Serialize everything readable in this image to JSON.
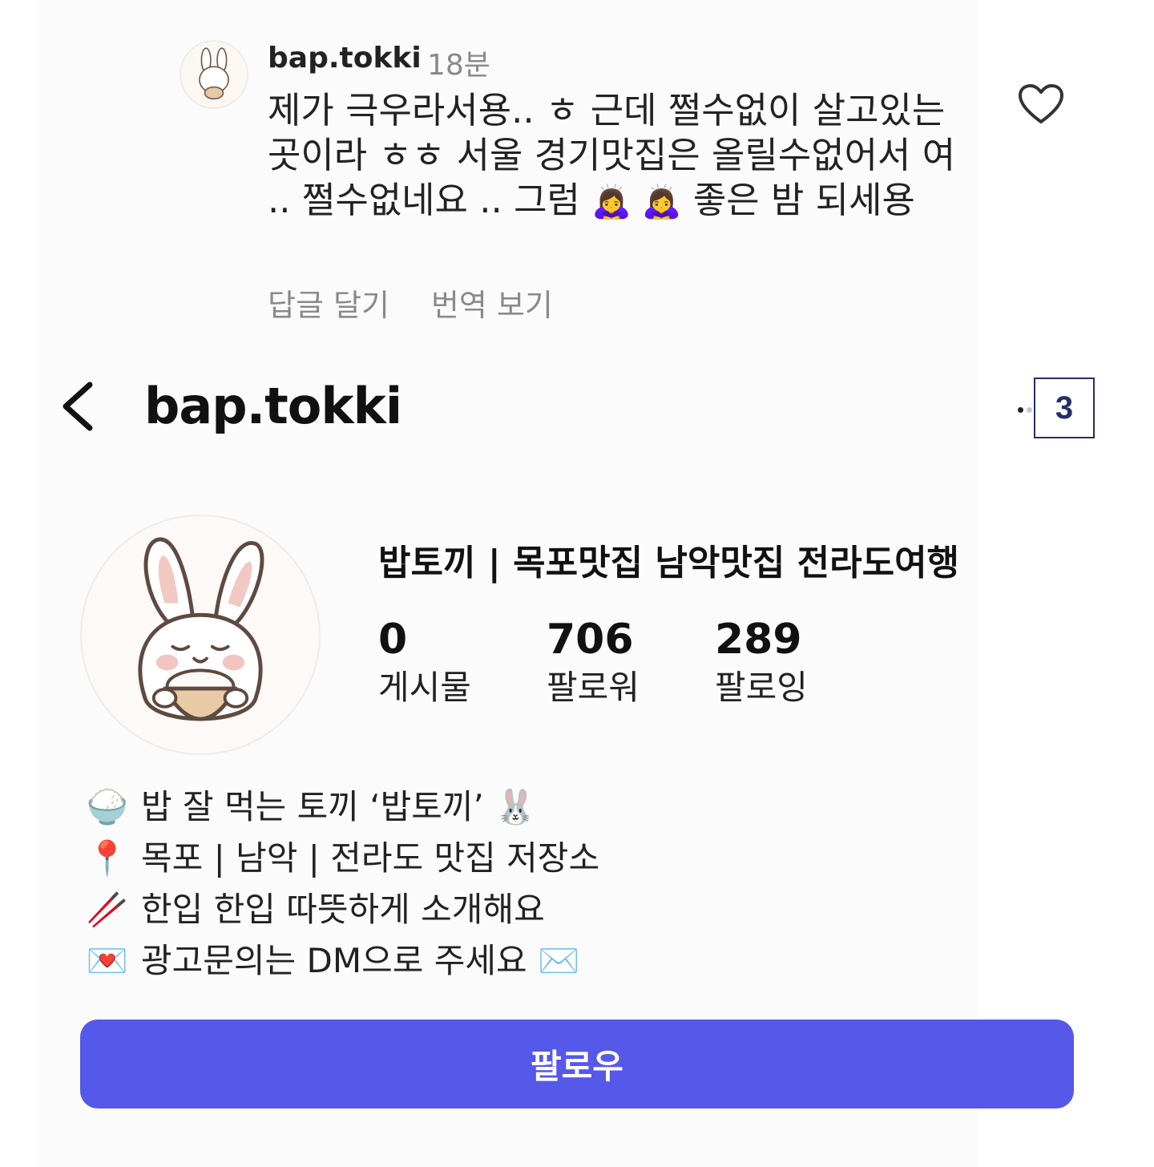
{
  "comment": {
    "username": "bap.tokki",
    "time": "18분",
    "text_before_emoji": "제가 극우라서용.. ㅎ 근데 쩔수없이 살고있는 곳이라 ㅎㅎ 서울 경기맛집은 올릴수없어서 여 .. 쩔수없네요 .. 그럼 ",
    "emoji": "🙇‍♀️ 🙇‍♀️",
    "text_after_emoji": " 좋은 밤 되세용",
    "reply_label": "답글 달기",
    "translate_label": "번역 보기",
    "like_icon": "heart-outline-icon"
  },
  "header": {
    "username": "bap.tokki",
    "back_icon": "chevron-left-icon",
    "more_icon": "more-dots-icon",
    "badge": "3"
  },
  "profile": {
    "name": "밥토끼 | 목포맛집 남악맛집 전라도여행",
    "stats": {
      "posts": {
        "count": "0",
        "label": "게시물"
      },
      "followers": {
        "count": "706",
        "label": "팔로워"
      },
      "following": {
        "count": "289",
        "label": "팔로잉"
      }
    }
  },
  "bio": [
    {
      "icon": "🍚",
      "text": "밥 잘 먹는 토끼 ‘밥토끼’ 🐰"
    },
    {
      "icon": "📍",
      "text": "목포 | 남악 | 전라도 맛집 저장소"
    },
    {
      "icon": "🥢",
      "text": "한입 한입 따뜻하게 소개해요"
    },
    {
      "icon": "💌",
      "text": "광고문의는 DM으로 주세요 ✉️"
    }
  ],
  "follow_button": {
    "label": "팔로우",
    "color": "#5558e8"
  },
  "colors": {
    "muted_text": "#8a8a8a",
    "badge_border": "#233066"
  }
}
